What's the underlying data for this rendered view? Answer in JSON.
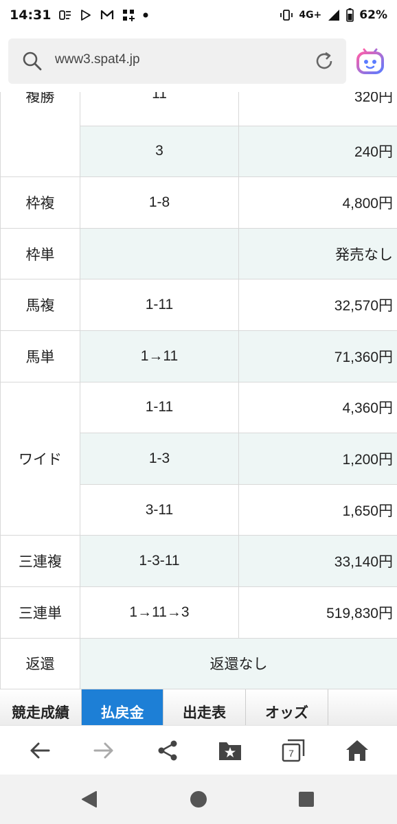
{
  "status_bar": {
    "time": "14:31",
    "network": "4G+",
    "battery": "62%"
  },
  "browser": {
    "url": "www3.spat4.jp"
  },
  "payout_table": {
    "rows": [
      {
        "kind": "複勝",
        "combo": "11",
        "amount": "320円",
        "kind_rowspan": 2
      },
      {
        "kind": "",
        "combo": "3",
        "amount": "240円"
      },
      {
        "kind": "枠複",
        "combo": "1-8",
        "amount": "4,800円"
      },
      {
        "kind": "枠単",
        "combo": "",
        "amount": "発売なし"
      },
      {
        "kind": "馬複",
        "combo": "1-11",
        "amount": "32,570円"
      },
      {
        "kind": "馬単",
        "combo": "1→11",
        "amount": "71,360円"
      },
      {
        "kind": "ワイド",
        "combo": "1-11",
        "amount": "4,360円",
        "kind_rowspan": 3
      },
      {
        "kind": "",
        "combo": "1-3",
        "amount": "1,200円"
      },
      {
        "kind": "",
        "combo": "3-11",
        "amount": "1,650円"
      },
      {
        "kind": "三連複",
        "combo": "1-3-11",
        "amount": "33,140円"
      },
      {
        "kind": "三連単",
        "combo": "1→11→3",
        "amount": "519,830円"
      }
    ],
    "refund": {
      "kind": "返還",
      "value": "返還なし"
    }
  },
  "tabs": [
    {
      "label": "競走成績",
      "active": false
    },
    {
      "label": "払戻金",
      "active": true
    },
    {
      "label": "出走表",
      "active": false
    },
    {
      "label": "オッズ",
      "active": false
    }
  ],
  "toolbar": {
    "tab_count": "7",
    "icons": [
      "back-arrow-icon",
      "forward-arrow-icon",
      "share-icon",
      "bookmark-folder-icon",
      "tabs-icon",
      "home-icon"
    ]
  },
  "colors": {
    "active_tab": "#1d7fd6",
    "alt_row": "#eef6f5",
    "assistant_gradient_start": "#ff5fa8",
    "assistant_gradient_end": "#5b7cff"
  }
}
